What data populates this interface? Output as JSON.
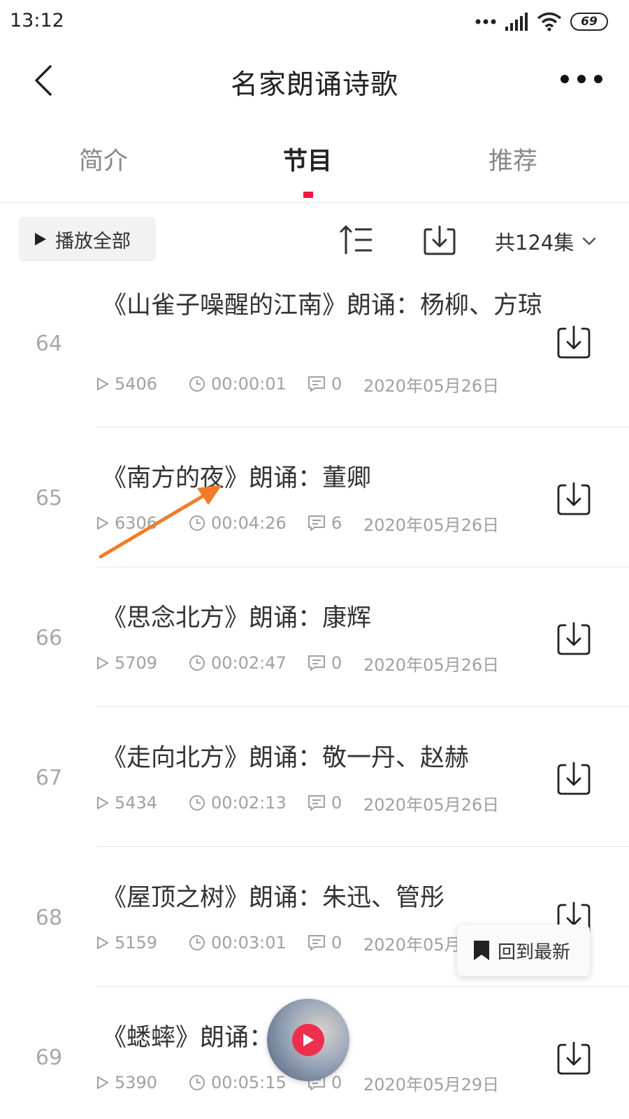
{
  "status_bar": {
    "time": "13:12",
    "battery": "69"
  },
  "header": {
    "title": "名家朗诵诗歌"
  },
  "tabs": [
    {
      "label": "简介",
      "active": false
    },
    {
      "label": "节目",
      "active": true
    },
    {
      "label": "推荐",
      "active": false
    }
  ],
  "toolbar": {
    "play_all_label": "播放全部",
    "episode_count": "共124集"
  },
  "episodes": [
    {
      "number": "64",
      "title": "《山雀子噪醒的江南》朗诵：杨柳、方琼",
      "plays": "5406",
      "duration": "00:00:01",
      "comments": "0",
      "date": "2020年05月26日"
    },
    {
      "number": "65",
      "title": "《南方的夜》朗诵：董卿",
      "plays": "6306",
      "duration": "00:04:26",
      "comments": "6",
      "date": "2020年05月26日"
    },
    {
      "number": "66",
      "title": "《思念北方》朗诵：康辉",
      "plays": "5709",
      "duration": "00:02:47",
      "comments": "0",
      "date": "2020年05月26日"
    },
    {
      "number": "67",
      "title": "《走向北方》朗诵：敬一丹、赵赫",
      "plays": "5434",
      "duration": "00:02:13",
      "comments": "0",
      "date": "2020年05月26日"
    },
    {
      "number": "68",
      "title": "《屋顶之树》朗诵：朱迅、管彤",
      "plays": "5159",
      "duration": "00:03:01",
      "comments": "0",
      "date": "2020年05月"
    },
    {
      "number": "69",
      "title": "《蟋蟀》朗诵：",
      "plays": "5390",
      "duration": "00:05:15",
      "comments": "0",
      "date": "2020年05月29日"
    }
  ],
  "floating": {
    "back_to_latest": "回到最新"
  },
  "colors": {
    "accent": "#f0173f",
    "text_primary": "#333333",
    "text_secondary": "#a0a0a0",
    "annotation": "#f07c2a"
  },
  "icons": [
    "back-icon",
    "more-icon",
    "play-icon",
    "sort-icon",
    "download-icon",
    "chevron-down-icon",
    "clock-icon",
    "comment-icon",
    "bookmark-icon"
  ]
}
